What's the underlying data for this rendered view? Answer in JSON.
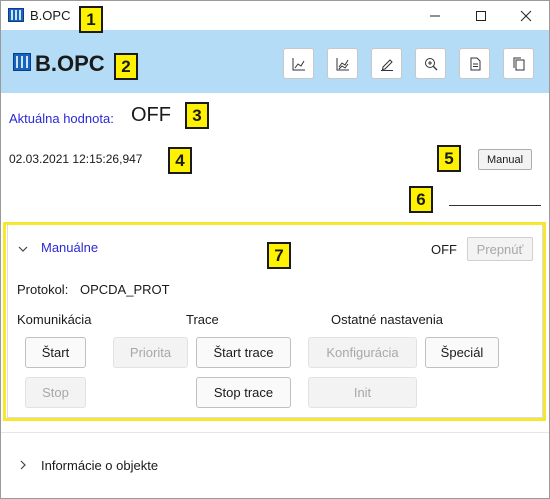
{
  "window": {
    "title": "B.OPC"
  },
  "header": {
    "logo_text": "B.OPC",
    "toolbar": [
      {
        "icon": "line-chart-icon"
      },
      {
        "icon": "multi-line-chart-icon"
      },
      {
        "icon": "edit-icon"
      },
      {
        "icon": "zoom-icon"
      },
      {
        "icon": "document-icon"
      },
      {
        "icon": "copy-icon"
      }
    ]
  },
  "value": {
    "label": "Aktuálna hodnota:",
    "current": "OFF",
    "timestamp": "02.03.2021 12:15:26,947",
    "manual_label": "Manual"
  },
  "manual_panel": {
    "header": "Manuálne",
    "state": "OFF",
    "toggle_label": "Prepnúť",
    "protocol_label": "Protokol:",
    "protocol_value": "OPCDA_PROT",
    "sections": {
      "communication": "Komunikácia",
      "trace": "Trace",
      "other": "Ostatné nastavenia"
    },
    "buttons": {
      "start": "Štart",
      "stop": "Stop",
      "priority": "Priorita",
      "start_trace": "Štart trace",
      "stop_trace": "Stop trace",
      "configuration": "Konfigurácia",
      "init": "Init",
      "special": "Špeciál"
    }
  },
  "info_panel": {
    "label": "Informácie o objekte"
  },
  "annotations": [
    "1",
    "2",
    "3",
    "4",
    "5",
    "6",
    "7"
  ],
  "colors": {
    "header_bg": "#b4dcf7",
    "link_blue": "#2a2ad6",
    "callout_yellow": "#fff200"
  }
}
